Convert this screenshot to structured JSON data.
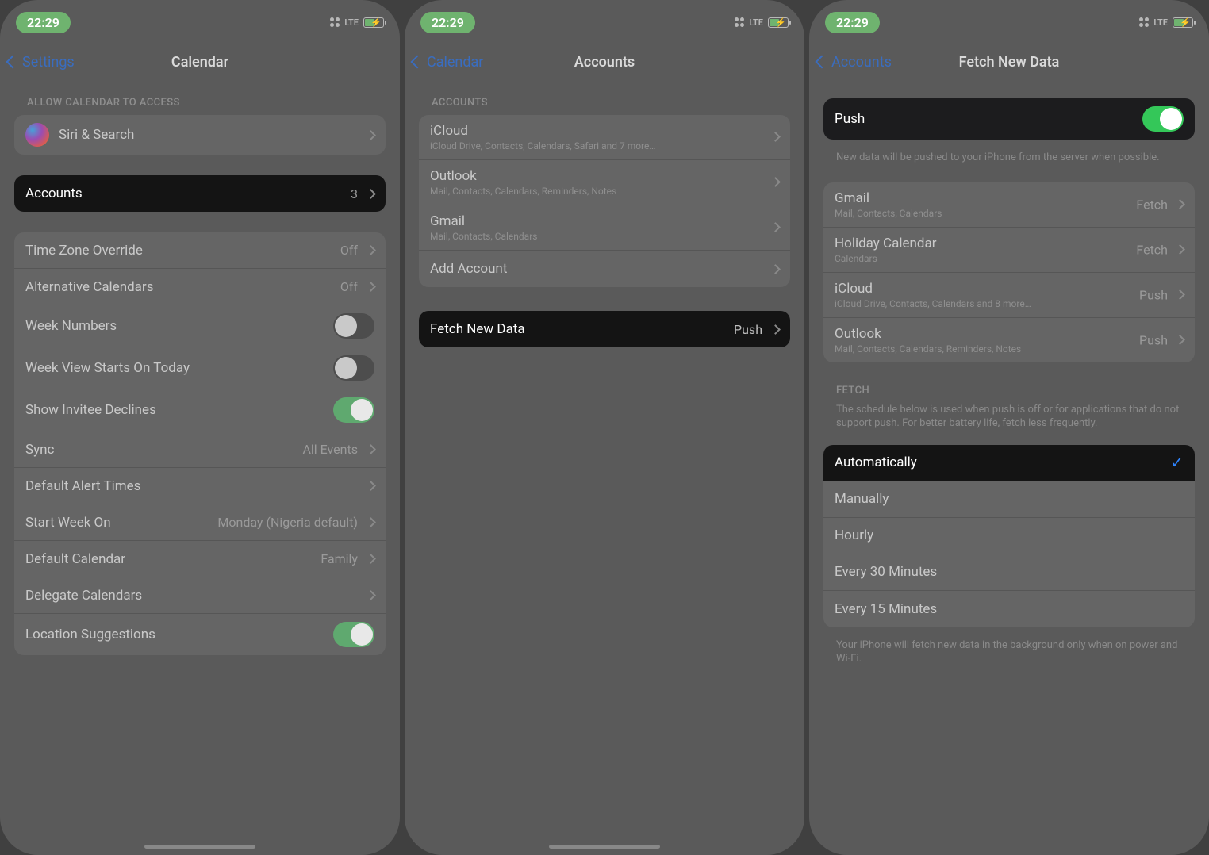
{
  "status": {
    "time": "22:29",
    "network": "LTE"
  },
  "screen1": {
    "back": "Settings",
    "title": "Calendar",
    "allow_header": "ALLOW CALENDAR TO ACCESS",
    "siri": "Siri & Search",
    "accounts_label": "Accounts",
    "accounts_count": "3",
    "rows": {
      "tzo": {
        "label": "Time Zone Override",
        "value": "Off"
      },
      "alt": {
        "label": "Alternative Calendars",
        "value": "Off"
      },
      "wk": {
        "label": "Week Numbers"
      },
      "wvs": {
        "label": "Week View Starts On Today"
      },
      "sid": {
        "label": "Show Invitee Declines"
      },
      "sync": {
        "label": "Sync",
        "value": "All Events"
      },
      "dat": {
        "label": "Default Alert Times"
      },
      "swo": {
        "label": "Start Week On",
        "value": "Monday (Nigeria default)"
      },
      "dc": {
        "label": "Default Calendar",
        "value": "Family"
      },
      "del": {
        "label": "Delegate Calendars"
      },
      "ls": {
        "label": "Location Suggestions"
      }
    }
  },
  "screen2": {
    "back": "Calendar",
    "title": "Accounts",
    "header": "ACCOUNTS",
    "icloud": {
      "label": "iCloud",
      "sub": "iCloud Drive, Contacts, Calendars, Safari and 7 more…"
    },
    "outlook": {
      "label": "Outlook",
      "sub": "Mail, Contacts, Calendars, Reminders, Notes"
    },
    "gmail": {
      "label": "Gmail",
      "sub": "Mail, Contacts, Calendars"
    },
    "add": "Add Account",
    "fetch": {
      "label": "Fetch New Data",
      "value": "Push"
    }
  },
  "screen3": {
    "back": "Accounts",
    "title": "Fetch New Data",
    "push_label": "Push",
    "push_footer": "New data will be pushed to your iPhone from the server when possible.",
    "accounts": {
      "gmail": {
        "label": "Gmail",
        "sub": "Mail, Contacts, Calendars",
        "value": "Fetch"
      },
      "holiday": {
        "label": "Holiday Calendar",
        "sub": "Calendars",
        "value": "Fetch"
      },
      "icloud": {
        "label": "iCloud",
        "sub": "iCloud Drive, Contacts, Calendars and 8 more…",
        "value": "Push"
      },
      "outlook": {
        "label": "Outlook",
        "sub": "Mail, Contacts, Calendars, Reminders, Notes",
        "value": "Push"
      }
    },
    "fetch_header": "FETCH",
    "fetch_desc": "The schedule below is used when push is off or for applications that do not support push. For better battery life, fetch less frequently.",
    "options": {
      "auto": "Automatically",
      "man": "Manually",
      "hr": "Hourly",
      "m30": "Every 30 Minutes",
      "m15": "Every 15 Minutes"
    },
    "options_footer": "Your iPhone will fetch new data in the background only when on power and Wi-Fi."
  }
}
